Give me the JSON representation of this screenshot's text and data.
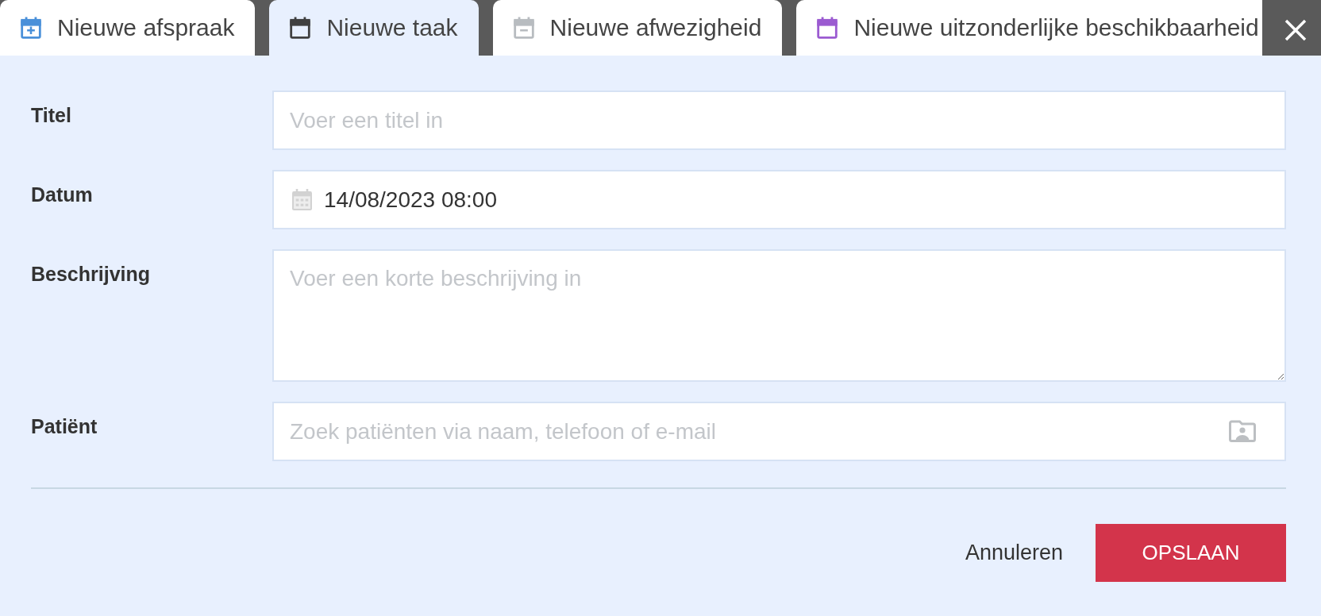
{
  "tabs": [
    {
      "label": "Nieuwe afspraak",
      "kind": "plus",
      "color": "#4a90d9",
      "selected": false
    },
    {
      "label": "Nieuwe taak",
      "kind": "plain",
      "color": "#404040",
      "selected": true
    },
    {
      "label": "Nieuwe afwezigheid",
      "kind": "minus",
      "color": "#b8bcc0",
      "selected": false
    },
    {
      "label": "Nieuwe uitzonderlijke beschikbaarheid",
      "kind": "plain",
      "color": "#9b5bd1",
      "selected": false
    }
  ],
  "form": {
    "fields": [
      {
        "label": "Titel",
        "kind": "text",
        "placeholder": "Voer een titel in"
      },
      {
        "label": "Datum",
        "kind": "date",
        "value": "14/08/2023 08:00"
      },
      {
        "label": "Beschrijving",
        "kind": "textarea",
        "placeholder": "Voer een korte beschrijving in"
      },
      {
        "label": "Patiënt",
        "kind": "search",
        "placeholder": "Zoek patiënten via naam, telefoon of e-mail"
      }
    ]
  },
  "buttons": [
    {
      "label": "Annuleren",
      "kind": "link"
    },
    {
      "label": "OPSLAAN",
      "kind": "primary"
    }
  ]
}
